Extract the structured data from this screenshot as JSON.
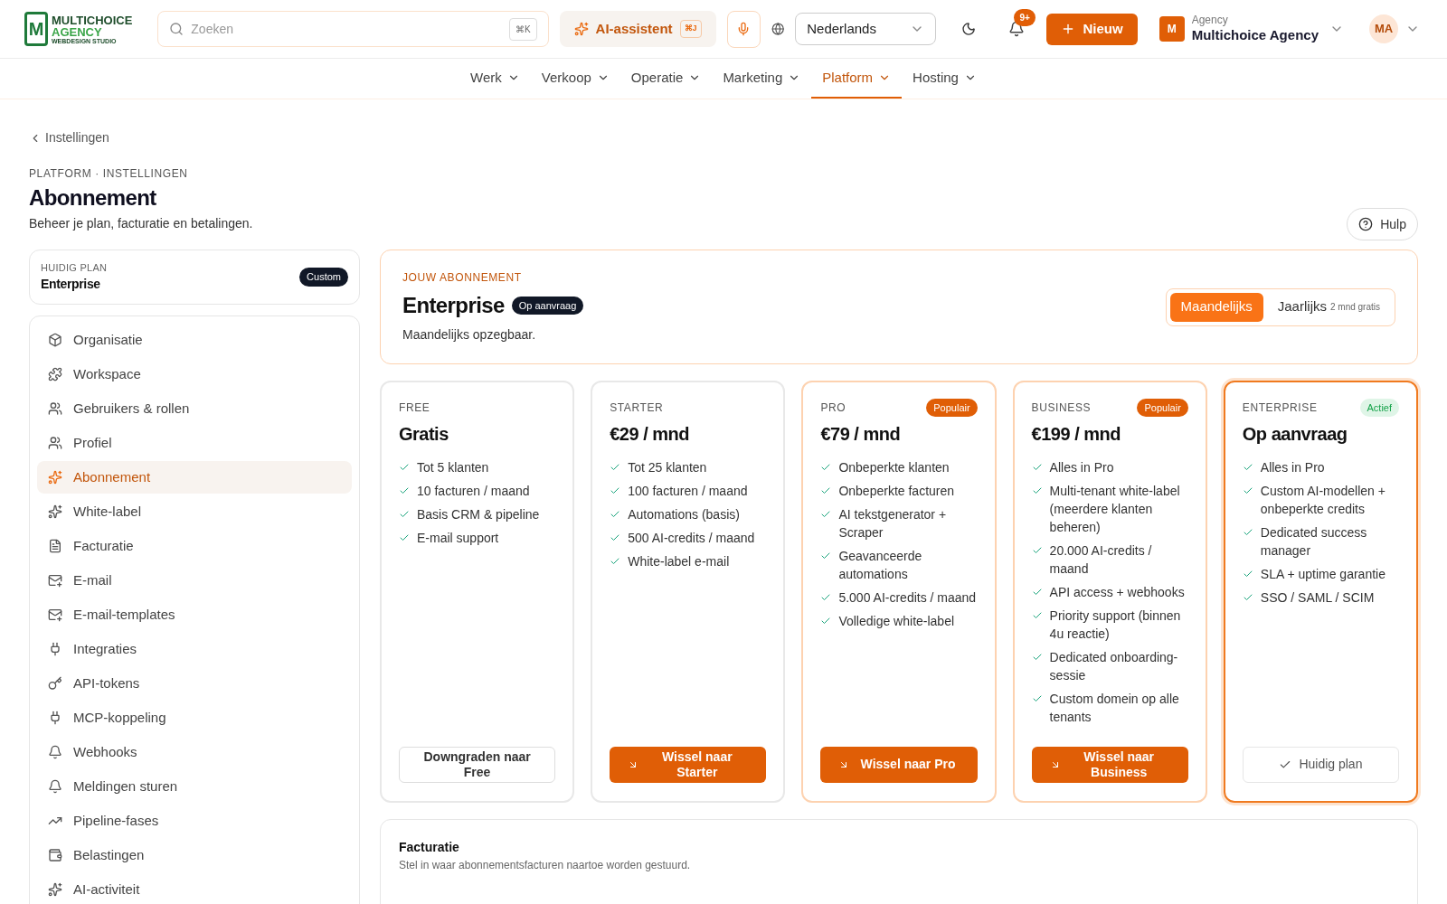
{
  "logo": {
    "line1": "MULTICHOICE",
    "line2": "AGENCY",
    "line3": "WEBDESIGN STUDIO",
    "mark": "M"
  },
  "search": {
    "placeholder": "Zoeken",
    "shortcut": "⌘K"
  },
  "ai_button": {
    "label": "AI-assistent",
    "shortcut": "⌘J"
  },
  "language": {
    "value": "Nederlands"
  },
  "notifications": {
    "badge": "9+"
  },
  "new_button": {
    "label": "Nieuw"
  },
  "account": {
    "initial": "M",
    "label": "Agency",
    "name": "Multichoice Agency"
  },
  "avatar": {
    "initials": "MA"
  },
  "nav": [
    {
      "label": "Werk",
      "selected": false
    },
    {
      "label": "Verkoop",
      "selected": false
    },
    {
      "label": "Operatie",
      "selected": false
    },
    {
      "label": "Marketing",
      "selected": false
    },
    {
      "label": "Platform",
      "selected": true
    },
    {
      "label": "Hosting",
      "selected": false
    }
  ],
  "breadcrumb": "Instellingen",
  "page": {
    "eyebrow": "PLATFORM · INSTELLINGEN",
    "title": "Abonnement",
    "subtitle": "Beheer je plan, facturatie en betalingen.",
    "help": "Hulp"
  },
  "current_plan": {
    "label": "HUIDIG PLAN",
    "name": "Enterprise",
    "badge": "Custom"
  },
  "sidebar": [
    {
      "label": "Organisatie",
      "selected": false
    },
    {
      "label": "Workspace",
      "selected": false
    },
    {
      "label": "Gebruikers & rollen",
      "selected": false
    },
    {
      "label": "Profiel",
      "selected": false
    },
    {
      "label": "Abonnement",
      "selected": true
    },
    {
      "label": "White-label",
      "selected": false
    },
    {
      "label": "Facturatie",
      "selected": false
    },
    {
      "label": "E-mail",
      "selected": false
    },
    {
      "label": "E-mail-templates",
      "selected": false
    },
    {
      "label": "Integraties",
      "selected": false
    },
    {
      "label": "API-tokens",
      "selected": false
    },
    {
      "label": "MCP-koppeling",
      "selected": false
    },
    {
      "label": "Webhooks",
      "selected": false
    },
    {
      "label": "Meldingen sturen",
      "selected": false
    },
    {
      "label": "Pipeline-fases",
      "selected": false
    },
    {
      "label": "Belastingen",
      "selected": false
    },
    {
      "label": "AI-activiteit",
      "selected": false
    }
  ],
  "subscription": {
    "eyebrow": "JOUW ABONNEMENT",
    "name": "Enterprise",
    "badge": "Op aanvraag",
    "note": "Maandelijks opzegbaar.",
    "billing_toggle": [
      {
        "label": "Maandelijks",
        "selected": true
      },
      {
        "label": "Jaarlijks",
        "extra": "2 mnd gratis",
        "selected": false
      }
    ]
  },
  "plans": [
    {
      "tier": "FREE",
      "price": "Gratis",
      "popular": false,
      "selected": false,
      "features": [
        "Tot 5 klanten",
        "10 facturen / maand",
        "Basis CRM & pipeline",
        "E-mail support"
      ],
      "action": {
        "kind": "downgrade",
        "label": "Downgraden naar Free"
      }
    },
    {
      "tier": "STARTER",
      "price": "€29 / mnd",
      "popular": false,
      "selected": false,
      "features": [
        "Tot 25 klanten",
        "100 facturen / maand",
        "Automations (basis)",
        "500 AI-credits / maand",
        "White-label e-mail"
      ],
      "action": {
        "kind": "switch",
        "label": "Wissel naar Starter"
      }
    },
    {
      "tier": "PRO",
      "price": "€79 / mnd",
      "popular": true,
      "badge": "Populair",
      "selected": false,
      "features": [
        "Onbeperkte klanten",
        "Onbeperkte facturen",
        "AI tekstgenerator + Scraper",
        "Geavanceerde automations",
        "5.000 AI-credits / maand",
        "Volledige white-label"
      ],
      "action": {
        "kind": "switch",
        "label": "Wissel naar Pro"
      }
    },
    {
      "tier": "BUSINESS",
      "price": "€199 / mnd",
      "popular": true,
      "badge": "Populair",
      "selected": false,
      "features": [
        "Alles in Pro",
        "Multi-tenant white-label (meerdere klanten beheren)",
        "20.000 AI-credits / maand",
        "API access + webhooks",
        "Priority support (binnen 4u reactie)",
        "Dedicated onboarding-sessie",
        "Custom domein op alle tenants"
      ],
      "action": {
        "kind": "switch",
        "label": "Wissel naar Business"
      }
    },
    {
      "tier": "ENTERPRISE",
      "price": "Op aanvraag",
      "popular": false,
      "badge": "Actief",
      "selected": true,
      "features": [
        "Alles in Pro",
        "Custom AI-modellen + onbeperkte credits",
        "Dedicated success manager",
        "SLA + uptime garantie",
        "SSO / SAML / SCIM"
      ],
      "action": {
        "kind": "current",
        "label": "Huidig plan"
      }
    }
  ],
  "billing": {
    "title": "Facturatie",
    "subtitle": "Stel in waar abonnementsfacturen naartoe worden gestuurd."
  }
}
